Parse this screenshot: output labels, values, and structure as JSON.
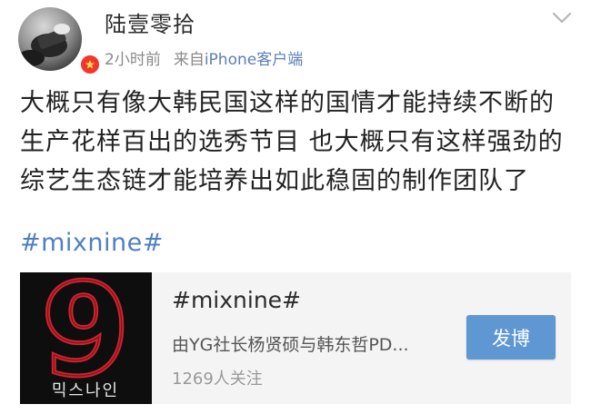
{
  "post": {
    "author": {
      "name": "陆壹零拾",
      "avatar_icon": "profile-photo",
      "badge_icon": "verified-badge-icon"
    },
    "meta": {
      "time": "2小时前",
      "source_prefix": "来自",
      "device": "iPhone客户端"
    },
    "text": "大概只有像大韩民国这样的国情才能持续不断的生产花样百出的选秀节目  也大概只有这样强劲的综艺生态链才能培养出如此稳固的制作团队了",
    "hashtag": "#mixnine#"
  },
  "topic_card": {
    "title": "#mixnine#",
    "description": "由YG社长杨贤硕与韩东哲PD...",
    "followers": "1269人关注",
    "button_label": "发博",
    "thumb_logo_digit": "9",
    "thumb_caption": "믹스나인"
  },
  "colors": {
    "link_blue": "#4f7fc3",
    "button_blue": "#5f97d3",
    "badge_red": "#f4352c",
    "logo_red": "#d2232f"
  }
}
